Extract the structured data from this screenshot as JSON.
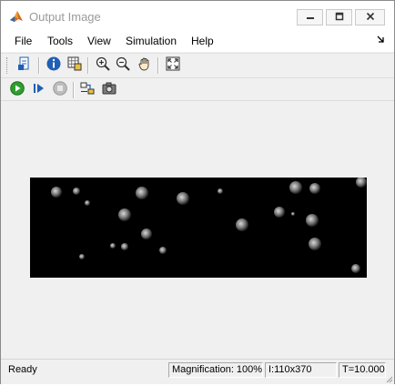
{
  "window": {
    "title": "Output Image"
  },
  "menu": {
    "items": [
      "File",
      "Tools",
      "View",
      "Simulation",
      "Help"
    ]
  },
  "toolbar": {
    "icons": [
      "print-icon",
      "info-icon",
      "pixel-region-icon",
      "zoom-in-icon",
      "zoom-out-icon",
      "pan-hand-icon",
      "fit-to-window-icon"
    ]
  },
  "toolbar2": {
    "icons": [
      "run-icon",
      "step-forward-icon",
      "stop-icon",
      "highlight-block-icon",
      "snapshot-camera-icon"
    ]
  },
  "status": {
    "ready": "Ready",
    "magnification": "Magnification: 100%",
    "size": "I:110x370",
    "time": "T=10.000"
  },
  "colors": {
    "accent_green": "#2e9e2e",
    "accent_blue": "#1f5fb4",
    "image_background": "#000000"
  }
}
